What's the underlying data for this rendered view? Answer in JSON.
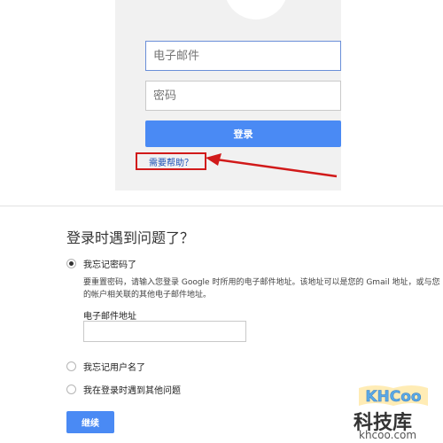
{
  "login": {
    "email_placeholder": "电子邮件",
    "password_placeholder": "密码",
    "signin_label": "登录",
    "help_link": "需要帮助？"
  },
  "recovery": {
    "title": "登录时遇到问题了？",
    "options": [
      {
        "label": "我忘记密码了",
        "selected": true
      },
      {
        "label": "我忘记用户名了",
        "selected": false
      },
      {
        "label": "我在登录时遇到其他问题",
        "selected": false
      }
    ],
    "description": "要重置密码，请输入您登录 Google 时所用的电子邮件地址。该地址可以是您的 Gmail 地址，或与您的帐户相关联的其他电子邮件地址。",
    "email_label": "电子邮件地址",
    "continue_label": "继续"
  },
  "watermark": {
    "logo": "KHCOO",
    "brand": "科技库",
    "site": "khcoo.com"
  },
  "colors": {
    "accent": "#4a8af4",
    "highlight": "#d11a1a",
    "link": "#1a4fb5"
  }
}
